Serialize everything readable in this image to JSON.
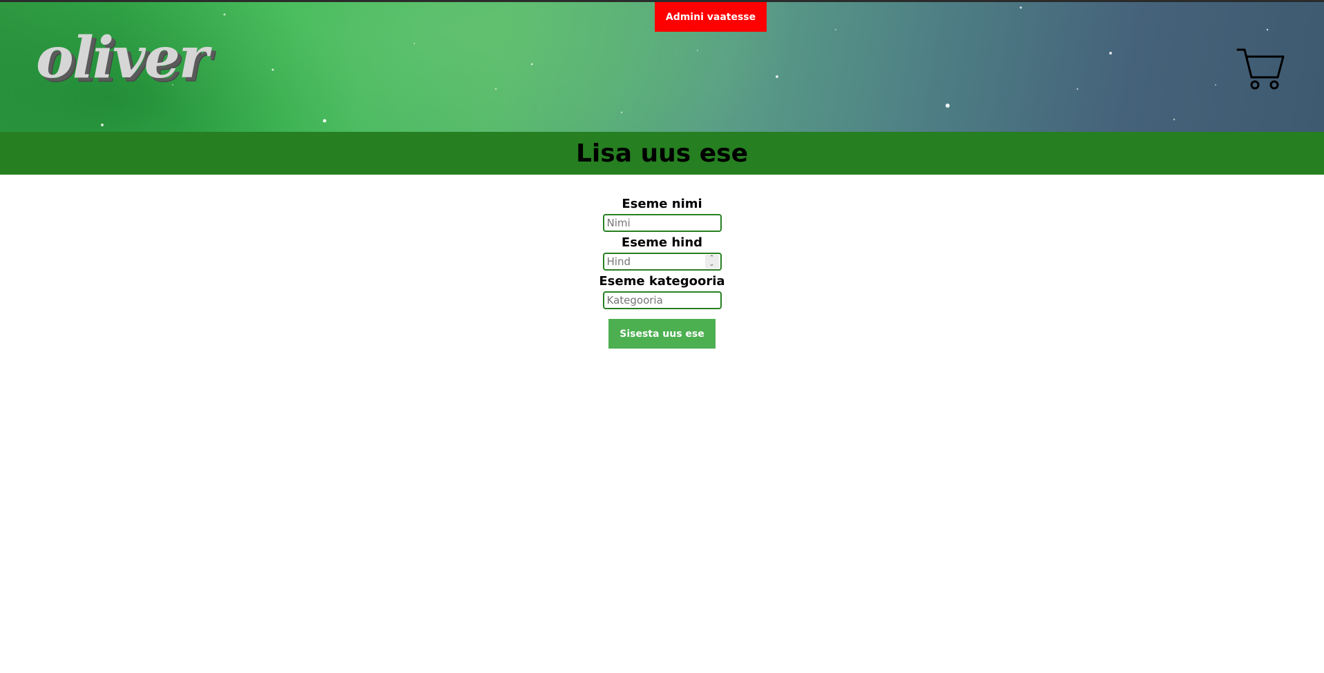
{
  "header": {
    "logo_text": "oliver",
    "admin_button_label": "Admini vaatesse",
    "cart_icon": "shopping-cart-icon"
  },
  "page": {
    "title": "Lisa uus ese"
  },
  "form": {
    "name_label": "Eseme nimi",
    "name_placeholder": "Nimi",
    "price_label": "Eseme hind",
    "price_placeholder": "Hind",
    "category_label": "Eseme kategooria",
    "category_placeholder": "Kategooria",
    "submit_label": "Sisesta uus ese"
  },
  "colors": {
    "title_band": "#267f21",
    "admin_button": "#ff0000",
    "submit_button": "#4caf50",
    "input_border": "#267f21"
  }
}
